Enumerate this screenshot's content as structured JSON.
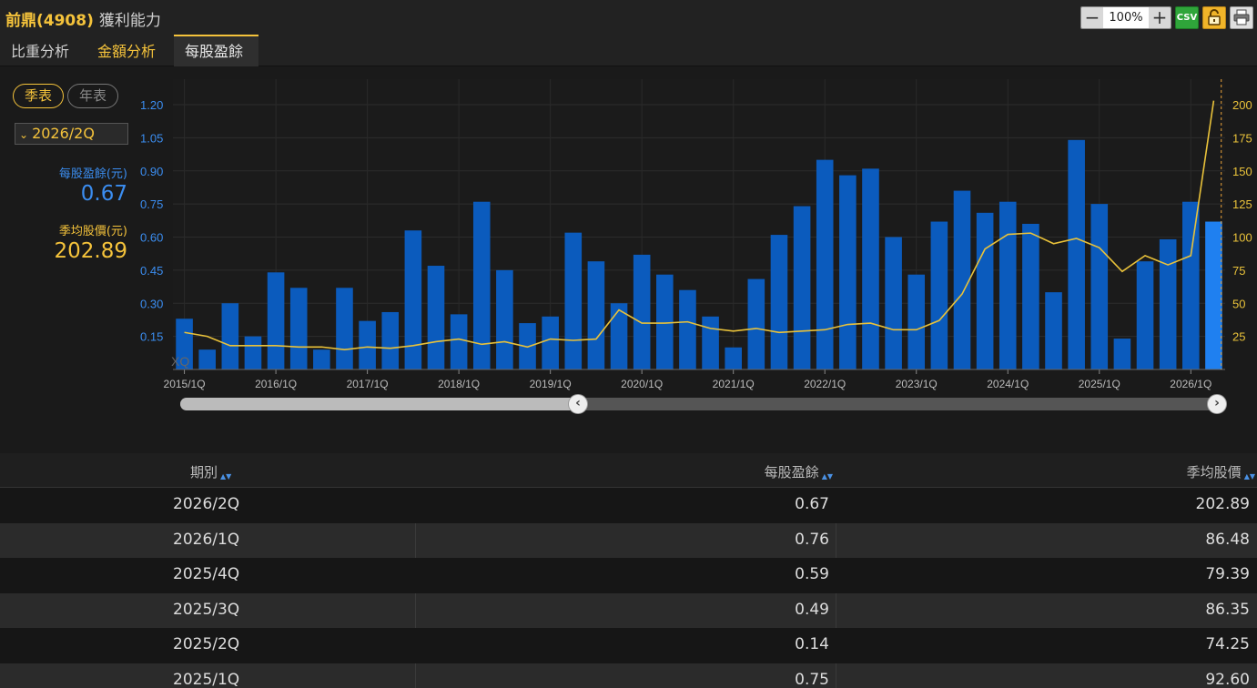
{
  "header": {
    "stock_name": "前鼎(4908)",
    "section_title": "獲利能力",
    "zoom_value": "100%",
    "csv_label": "CSV"
  },
  "tabs": [
    {
      "label": "比重分析"
    },
    {
      "label": "金額分析"
    },
    {
      "label": "每股盈餘"
    }
  ],
  "controls": {
    "quarterly_label": "季表",
    "annual_label": "年表",
    "selected_period": "2026/2Q"
  },
  "stats": {
    "eps_label": "每股盈餘(元)",
    "eps_value": "0.67",
    "price_label": "季均股價(元)",
    "price_value": "202.89"
  },
  "colors": {
    "bar": "#0b5bbd",
    "bar_highlight": "#1f80f0",
    "line": "#e9c23a",
    "accent": "#f5c33b"
  },
  "chart_data": {
    "type": "bar",
    "watermark": "XQ",
    "x_tick_labels": [
      "2015/1Q",
      "2016/1Q",
      "2017/1Q",
      "2018/1Q",
      "2019/1Q",
      "2020/1Q",
      "2021/1Q",
      "2022/1Q",
      "2023/1Q",
      "2024/1Q",
      "2025/1Q",
      "2026/1Q"
    ],
    "left_axis": {
      "ticks": [
        "0.15",
        "0.30",
        "0.45",
        "0.60",
        "0.75",
        "0.90",
        "1.05",
        "1.20"
      ],
      "range": [
        0,
        1.2
      ]
    },
    "right_axis": {
      "ticks": [
        "25",
        "50",
        "75",
        "100",
        "125",
        "150",
        "175",
        "200"
      ],
      "range": [
        0,
        200
      ]
    },
    "categories": [
      "2015/1Q",
      "2015/2Q",
      "2015/3Q",
      "2015/4Q",
      "2016/1Q",
      "2016/2Q",
      "2016/3Q",
      "2016/4Q",
      "2017/1Q",
      "2017/2Q",
      "2017/3Q",
      "2017/4Q",
      "2018/1Q",
      "2018/2Q",
      "2018/3Q",
      "2018/4Q",
      "2019/1Q",
      "2019/2Q",
      "2019/3Q",
      "2019/4Q",
      "2020/1Q",
      "2020/2Q",
      "2020/3Q",
      "2020/4Q",
      "2021/1Q",
      "2021/2Q",
      "2021/3Q",
      "2021/4Q",
      "2022/1Q",
      "2022/2Q",
      "2022/3Q",
      "2022/4Q",
      "2023/1Q",
      "2023/2Q",
      "2023/3Q",
      "2023/4Q",
      "2024/1Q",
      "2024/2Q",
      "2024/3Q",
      "2024/4Q",
      "2025/1Q",
      "2025/2Q",
      "2025/3Q",
      "2025/4Q",
      "2026/1Q",
      "2026/2Q"
    ],
    "series": [
      {
        "axis": "left",
        "type": "bar",
        "values": [
          0.23,
          0.09,
          0.3,
          0.15,
          0.44,
          0.37,
          0.09,
          0.37,
          0.22,
          0.26,
          0.63,
          0.47,
          0.25,
          0.76,
          0.45,
          0.21,
          0.24,
          0.62,
          0.49,
          0.3,
          0.52,
          0.43,
          0.36,
          0.24,
          0.1,
          0.41,
          0.61,
          0.74,
          0.95,
          0.88,
          0.91,
          0.6,
          0.43,
          0.67,
          0.81,
          0.71,
          0.76,
          0.66,
          0.35,
          1.04,
          0.75,
          0.14,
          0.49,
          0.59,
          0.76,
          0.67
        ]
      },
      {
        "axis": "right",
        "type": "line",
        "values": [
          28,
          25,
          18,
          18,
          18,
          17,
          17,
          15,
          17,
          16,
          18,
          21,
          23,
          19,
          21,
          17,
          23,
          22,
          23,
          45,
          35,
          35,
          36,
          31,
          29,
          31,
          28,
          29,
          30,
          34,
          35,
          30,
          30,
          37,
          57,
          91,
          102,
          103,
          95,
          99,
          92,
          74,
          86,
          79,
          86,
          203
        ]
      }
    ],
    "highlight_index": 45,
    "grid": true
  },
  "table": {
    "headers": {
      "period": "期別",
      "eps": "每股盈餘",
      "price": "季均股價"
    },
    "rows": [
      {
        "period": "2026/2Q",
        "eps": "0.67",
        "price": "202.89"
      },
      {
        "period": "2026/1Q",
        "eps": "0.76",
        "price": "86.48"
      },
      {
        "period": "2025/4Q",
        "eps": "0.59",
        "price": "79.39"
      },
      {
        "period": "2025/3Q",
        "eps": "0.49",
        "price": "86.35"
      },
      {
        "period": "2025/2Q",
        "eps": "0.14",
        "price": "74.25"
      },
      {
        "period": "2025/1Q",
        "eps": "0.75",
        "price": "92.60"
      }
    ]
  }
}
